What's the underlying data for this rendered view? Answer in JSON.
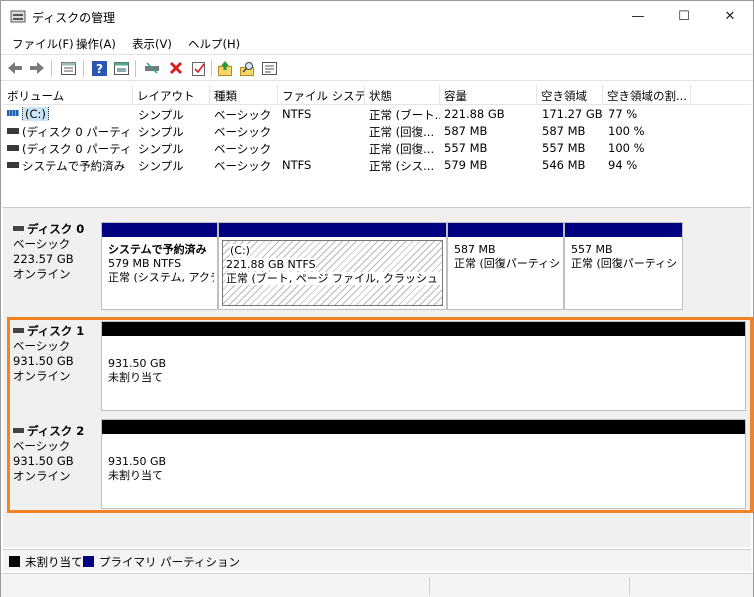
{
  "window": {
    "title": "ディスクの管理",
    "min_glyph": "—",
    "max_glyph": "☐",
    "close_glyph": "✕"
  },
  "menu": [
    "ファイル(F)",
    "操作(A)",
    "表示(V)",
    "ヘルプ(H)"
  ],
  "toolbar": {
    "icons": [
      "back-arrow-icon",
      "forward-arrow-icon",
      "properties-list-icon",
      "help-icon",
      "console-tree-icon",
      "connect-drive-icon",
      "delete-icon",
      "check-properties-icon",
      "import-icon",
      "search-icon",
      "list-view-icon"
    ]
  },
  "volume_list": {
    "columns": [
      "ボリューム",
      "レイアウト",
      "種類",
      "ファイル システム",
      "状態",
      "容量",
      "空き領域",
      "空き領域の割..."
    ],
    "rows": [
      [
        "(C:)",
        "シンプル",
        "ベーシック",
        "NTFS",
        "正常 (ブート...",
        "221.88 GB",
        "171.27 GB",
        "77 %"
      ],
      [
        "(ディスク 0 パーティシ...",
        "シンプル",
        "ベーシック",
        "",
        "正常 (回復...",
        "587 MB",
        "587 MB",
        "100 %"
      ],
      [
        "(ディスク 0 パーティシ...",
        "シンプル",
        "ベーシック",
        "",
        "正常 (回復...",
        "557 MB",
        "557 MB",
        "100 %"
      ],
      [
        "システムで予約済み",
        "シンプル",
        "ベーシック",
        "NTFS",
        "正常 (シス...",
        "579 MB",
        "546 MB",
        "94 %"
      ]
    ]
  },
  "disks": [
    {
      "name": "ディスク 0",
      "type": "ベーシック",
      "size": "223.57 GB",
      "status": "オンライン",
      "partitions": [
        {
          "title": "システムで予約済み",
          "size": "579 MB NTFS",
          "status": "正常 (システム, アクテ"
        },
        {
          "title": "(C:)",
          "size": "221.88 GB NTFS",
          "status": "正常 (ブート, ページ ファイル, クラッシュ ダンプ,"
        },
        {
          "title": "",
          "size": "587 MB",
          "status": "正常 (回復パーティシ"
        },
        {
          "title": "",
          "size": "557 MB",
          "status": "正常 (回復パーティシ"
        }
      ]
    },
    {
      "name": "ディスク 1",
      "type": "ベーシック",
      "size": "931.50 GB",
      "status": "オンライン",
      "partitions": [
        {
          "size": "931.50 GB",
          "status": "未割り当て"
        }
      ]
    },
    {
      "name": "ディスク 2",
      "type": "ベーシック",
      "size": "931.50 GB",
      "status": "オンライン",
      "partitions": [
        {
          "size": "931.50 GB",
          "status": "未割り当て"
        }
      ]
    }
  ],
  "legend": [
    {
      "label": "未割り当て",
      "color": "#000000"
    },
    {
      "label": "プライマリ パーティション",
      "color": "#000080"
    }
  ],
  "colors": {
    "highlight": "#f58220",
    "primary_partition": "#000080",
    "unallocated": "#000000",
    "selection": "#cce4f7"
  }
}
